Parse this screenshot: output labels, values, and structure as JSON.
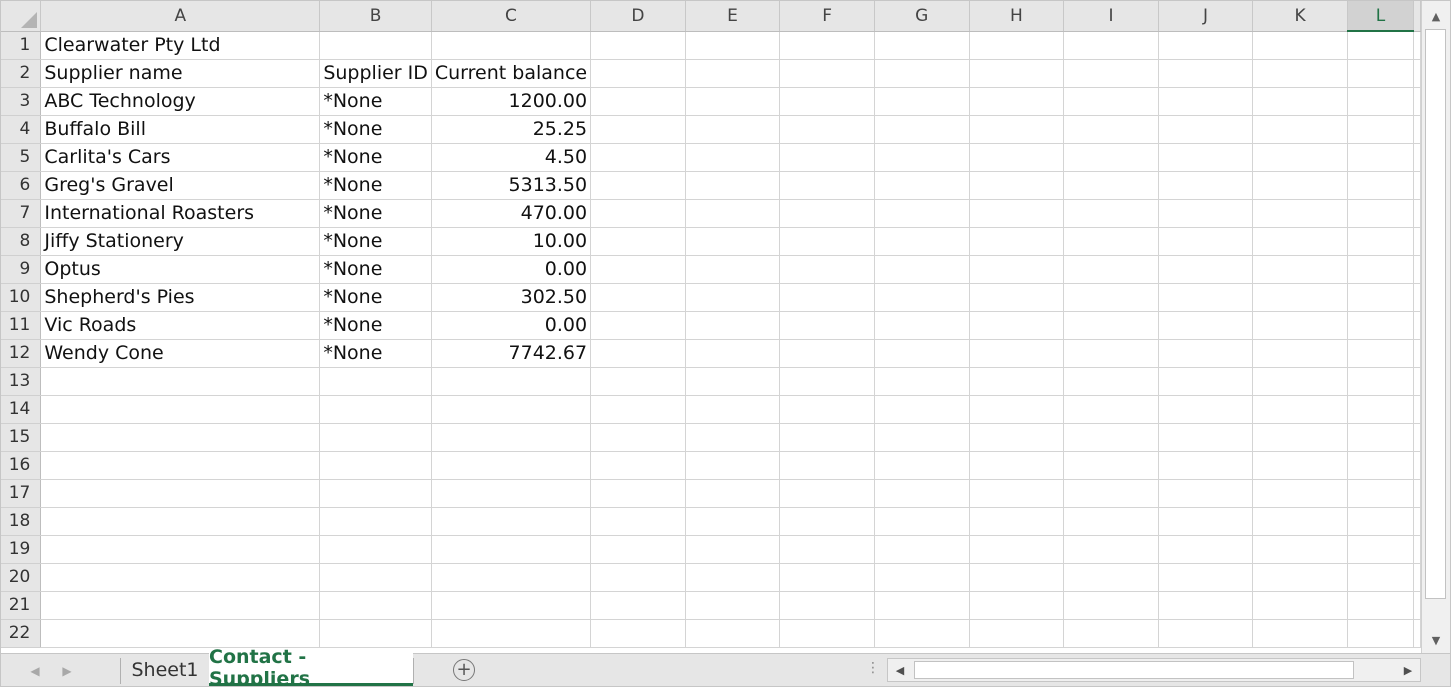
{
  "columns": [
    "A",
    "B",
    "C",
    "D",
    "E",
    "F",
    "G",
    "H",
    "I",
    "J",
    "K",
    "L"
  ],
  "selected_column": "L",
  "rows": [
    {
      "n": "1",
      "a": "Clearwater Pty Ltd",
      "b": "",
      "c": ""
    },
    {
      "n": "2",
      "a": "Supplier name",
      "b": "Supplier ID",
      "c": "Current balance"
    },
    {
      "n": "3",
      "a": "ABC Technology",
      "b": "*None",
      "c": "1200.00"
    },
    {
      "n": "4",
      "a": "Buffalo Bill",
      "b": "*None",
      "c": "25.25"
    },
    {
      "n": "5",
      "a": "Carlita's Cars",
      "b": "*None",
      "c": "4.50"
    },
    {
      "n": "6",
      "a": "Greg's Gravel",
      "b": "*None",
      "c": "5313.50"
    },
    {
      "n": "7",
      "a": "International Roasters",
      "b": "*None",
      "c": "470.00"
    },
    {
      "n": "8",
      "a": "Jiffy Stationery",
      "b": "*None",
      "c": "10.00"
    },
    {
      "n": "9",
      "a": "Optus",
      "b": "*None",
      "c": "0.00"
    },
    {
      "n": "10",
      "a": "Shepherd's Pies",
      "b": "*None",
      "c": "302.50"
    },
    {
      "n": "11",
      "a": "Vic Roads",
      "b": "*None",
      "c": "0.00"
    },
    {
      "n": "12",
      "a": "Wendy Cone",
      "b": "*None",
      "c": "7742.67"
    },
    {
      "n": "13",
      "a": "",
      "b": "",
      "c": ""
    },
    {
      "n": "14",
      "a": "",
      "b": "",
      "c": ""
    },
    {
      "n": "15",
      "a": "",
      "b": "",
      "c": ""
    },
    {
      "n": "16",
      "a": "",
      "b": "",
      "c": ""
    },
    {
      "n": "17",
      "a": "",
      "b": "",
      "c": ""
    },
    {
      "n": "18",
      "a": "",
      "b": "",
      "c": ""
    },
    {
      "n": "19",
      "a": "",
      "b": "",
      "c": ""
    },
    {
      "n": "20",
      "a": "",
      "b": "",
      "c": ""
    },
    {
      "n": "21",
      "a": "",
      "b": "",
      "c": ""
    },
    {
      "n": "22",
      "a": "",
      "b": "",
      "c": ""
    }
  ],
  "tabs": [
    {
      "label": "Sheet1",
      "active": false
    },
    {
      "label": "Contact - Suppliers",
      "active": true
    }
  ],
  "icons": {
    "corner": "select-all-triangle",
    "tab_prev": "◀",
    "tab_next": "▶",
    "add_sheet": "+",
    "scroll_up": "▲",
    "scroll_down": "▼",
    "scroll_left": "◀",
    "scroll_right": "▶",
    "split": "⋮"
  },
  "colors": {
    "accent": "#217346",
    "header_bg": "#e6e6e6",
    "gridline": "#d4d4d4"
  }
}
